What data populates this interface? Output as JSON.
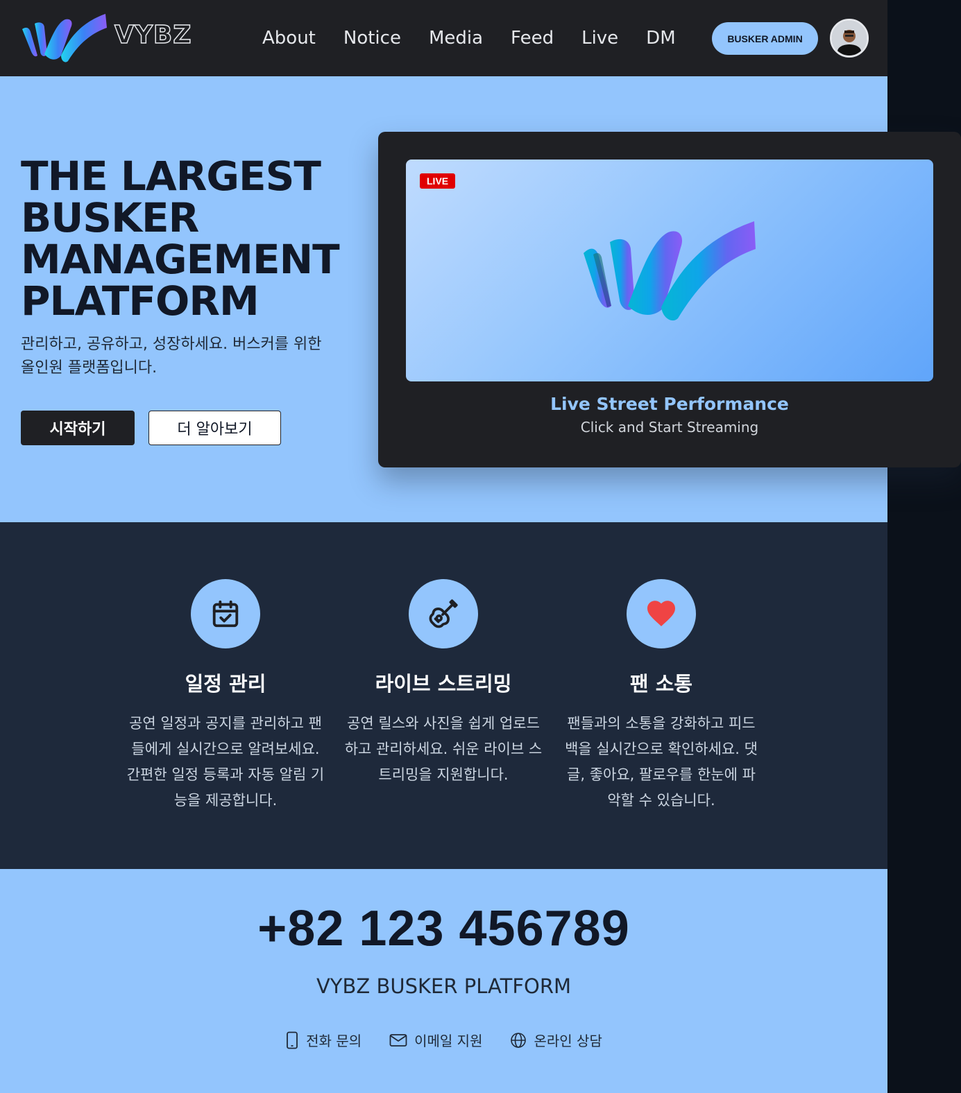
{
  "header": {
    "brand": "VYBZ",
    "nav": [
      "About",
      "Notice",
      "Media",
      "Feed",
      "Live",
      "DM"
    ],
    "admin_button": "BUSKER ADMIN"
  },
  "hero": {
    "title_lines": [
      "THE LARGEST",
      "BUSKER",
      "MANAGEMENT",
      "PLATFORM"
    ],
    "subtitle": "관리하고, 공유하고, 성장하세요. 버스커를 위한 올인원 플랫폼입니다.",
    "start_button": "시작하기",
    "more_button": "더 알아보기"
  },
  "live_card": {
    "badge": "LIVE",
    "title": "Live Street Performance",
    "caption": "Click and Start Streaming"
  },
  "features": [
    {
      "icon": "calendar-check-icon",
      "title": "일정 관리",
      "desc": "공연 일정과 공지를 관리하고 팬들에게 실시간으로 알려보세요. 간편한 일정 등록과 자동 알림 기능을 제공합니다."
    },
    {
      "icon": "guitar-icon",
      "title": "라이브 스트리밍",
      "desc": "공연 릴스와 사진을 쉽게 업로드하고 관리하세요. 쉬운 라이브 스트리밍을 지원합니다."
    },
    {
      "icon": "heart-icon",
      "title": "팬 소통",
      "desc": "팬들과의 소통을 강화하고 피드백을 실시간으로 확인하세요. 댓글, 좋아요, 팔로우를 한눈에 파악할 수 있습니다."
    }
  ],
  "contact": {
    "phone": "+82 123 456789",
    "platform_name": "VYBZ BUSKER PLATFORM",
    "items": [
      {
        "icon": "phone-icon",
        "label": "전화 문의"
      },
      {
        "icon": "mail-icon",
        "label": "이메일 지원"
      },
      {
        "icon": "globe-icon",
        "label": "온라인 상담"
      }
    ]
  },
  "colors": {
    "accent": "#93c5fd",
    "dark": "#1f2024",
    "features_bg": "#1e293b",
    "live_badge": "#e00000",
    "heart": "#ef4444"
  }
}
